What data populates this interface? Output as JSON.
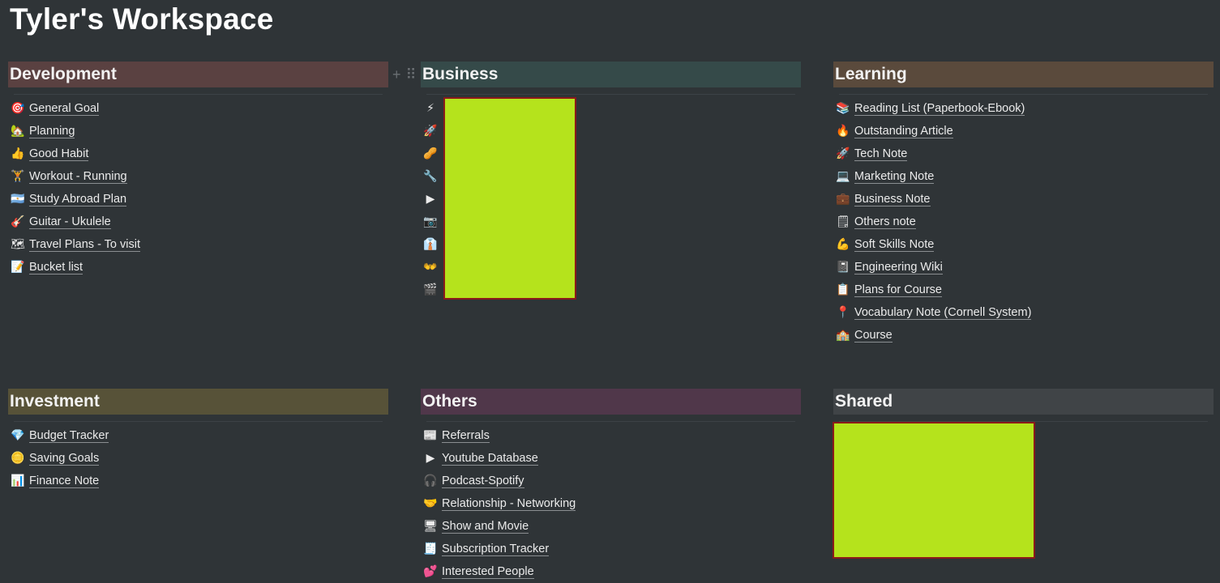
{
  "page": {
    "title": "Tyler's Workspace"
  },
  "colors": {
    "background": "#2f3437",
    "development": "#5a4141",
    "business": "#354a49",
    "learning": "#5a4a3c",
    "investment": "#575238",
    "others": "#50374a",
    "shared": "#404447",
    "redaction": "#b5e31c"
  },
  "drag": {
    "plus": "+",
    "handle": "⠿"
  },
  "sections": {
    "development": {
      "title": "Development",
      "items": [
        {
          "icon": "🎯",
          "icon_name": "target-icon",
          "label": "General Goal"
        },
        {
          "icon": "🏡",
          "icon_name": "house-icon",
          "label": "Planning"
        },
        {
          "icon": "👍",
          "icon_name": "thumbs-up-icon",
          "label": "Good Habit"
        },
        {
          "icon": "🏋",
          "icon_name": "weightlifter-icon",
          "label": "Workout - Running"
        },
        {
          "icon": "🇦🇷",
          "icon_name": "flag-icon",
          "label": "Study Abroad Plan"
        },
        {
          "icon": "🎸",
          "icon_name": "guitar-icon",
          "label": "Guitar - Ukulele"
        },
        {
          "icon": "🗺",
          "icon_name": "map-icon",
          "label": "Travel Plans - To visit"
        },
        {
          "icon": "📝",
          "icon_name": "memo-icon",
          "label": "Bucket list"
        }
      ]
    },
    "business": {
      "title": "Business",
      "items": [
        {
          "icon": "⚡",
          "icon_name": "lightning-icon",
          "label": ""
        },
        {
          "icon": "🚀",
          "icon_name": "rocket-icon",
          "label": ""
        },
        {
          "icon": "🥜",
          "icon_name": "peanut-icon",
          "label": ""
        },
        {
          "icon": "🔧",
          "icon_name": "tool-icon",
          "label": ""
        },
        {
          "icon": "▶",
          "icon_name": "youtube-icon",
          "label": ""
        },
        {
          "icon": "📷",
          "icon_name": "instagram-icon",
          "label": ""
        },
        {
          "icon": "👔",
          "icon_name": "necktie-icon",
          "label": ""
        },
        {
          "icon": "👐",
          "icon_name": "open-hands-icon",
          "label": ""
        },
        {
          "icon": "🎬",
          "icon_name": "clapper-icon",
          "label": ""
        }
      ]
    },
    "learning": {
      "title": "Learning",
      "items": [
        {
          "icon": "📚",
          "icon_name": "books-icon",
          "label": "Reading List (Paperbook-Ebook)"
        },
        {
          "icon": "🔥",
          "icon_name": "fire-icon",
          "label": "Outstanding Article"
        },
        {
          "icon": "🚀",
          "icon_name": "rocket-icon",
          "label": "Tech Note"
        },
        {
          "icon": "💻",
          "icon_name": "laptop-icon",
          "label": "Marketing Note"
        },
        {
          "icon": "💼",
          "icon_name": "briefcase-icon",
          "label": "Business Note"
        },
        {
          "icon": "🗒",
          "icon_name": "notepad-icon",
          "label": "Others note"
        },
        {
          "icon": "💪",
          "icon_name": "flexed-bicep-icon",
          "label": "Soft Skills Note"
        },
        {
          "icon": "📓",
          "icon_name": "notebook-icon",
          "label": "Engineering Wiki"
        },
        {
          "icon": "📋",
          "icon_name": "clipboard-icon",
          "label": "Plans for Course"
        },
        {
          "icon": "📍",
          "icon_name": "pin-icon",
          "label": "Vocabulary Note (Cornell System)"
        },
        {
          "icon": "🏫",
          "icon_name": "school-icon",
          "label": "Course"
        }
      ]
    },
    "investment": {
      "title": "Investment",
      "items": [
        {
          "icon": "💎",
          "icon_name": "gem-icon",
          "label": "Budget Tracker"
        },
        {
          "icon": "🪙",
          "icon_name": "coins-icon",
          "label": "Saving Goals"
        },
        {
          "icon": "📊",
          "icon_name": "bar-chart-icon",
          "label": "Finance Note"
        }
      ]
    },
    "others": {
      "title": "Others",
      "items": [
        {
          "icon": "📰",
          "icon_name": "newspaper-icon",
          "label": "Referrals"
        },
        {
          "icon": "▶",
          "icon_name": "youtube-icon",
          "label": "Youtube Database"
        },
        {
          "icon": "🎧",
          "icon_name": "spotify-icon",
          "label": "Podcast-Spotify"
        },
        {
          "icon": "🤝",
          "icon_name": "handshake-icon",
          "label": "Relationship - Networking"
        },
        {
          "icon": "🖥",
          "icon_name": "monitor-icon",
          "label": "Show and Movie"
        },
        {
          "icon": "🧾",
          "icon_name": "receipt-icon",
          "label": "Subscription Tracker"
        },
        {
          "icon": "💕",
          "icon_name": "hearts-icon",
          "label": "Interested People"
        }
      ]
    },
    "shared": {
      "title": "Shared",
      "items": []
    }
  }
}
